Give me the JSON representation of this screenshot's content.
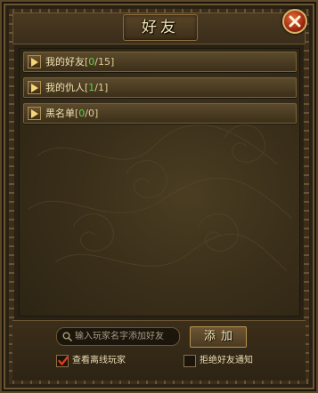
{
  "title": "好友",
  "close_icon": "close-icon",
  "groups": [
    {
      "name": "我的好友",
      "bracket_open": "[",
      "count_a": "0",
      "count_b": "/15]"
    },
    {
      "name": "我的仇人",
      "bracket_open": "[",
      "count_a": "1",
      "count_b": "/1]"
    },
    {
      "name": "黑名单",
      "bracket_open": "[",
      "count_a": "0",
      "count_b": "/0]"
    }
  ],
  "search": {
    "placeholder": "输入玩家名字添加好友",
    "value": ""
  },
  "add_button": "添加",
  "options": {
    "show_offline": {
      "label": "查看离线玩家",
      "checked": true
    },
    "reject_notice": {
      "label": "拒绝好友通知",
      "checked": false
    }
  },
  "colors": {
    "online_count": "#5fd34a",
    "close_button": "#9e2a10",
    "checkmark": "#e03c1c"
  }
}
